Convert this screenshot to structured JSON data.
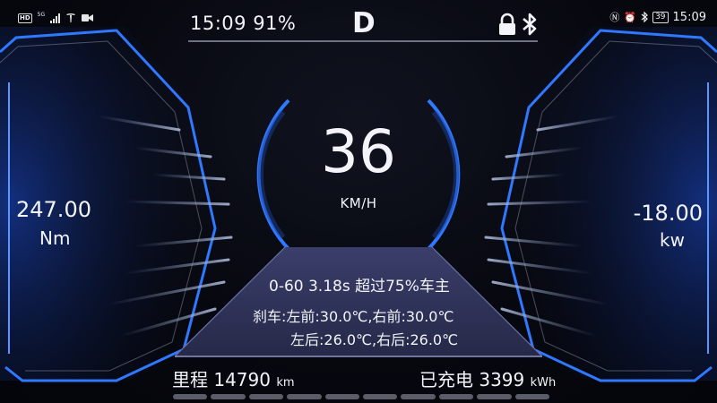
{
  "status_bar": {
    "left_network_badge": "HD",
    "left_network_type": "5G",
    "right_time": "15:09",
    "battery_level": "39",
    "icons": [
      "tesla-logo-icon",
      "video-icon",
      "nfc-icon",
      "alarm-icon",
      "bluetooth-icon",
      "battery-icon"
    ]
  },
  "top_bar": {
    "time_battery": "15:09 91%",
    "gear": "D"
  },
  "speed": {
    "value": "36",
    "unit": "KM/H"
  },
  "torque": {
    "value": "247.00",
    "unit": "Nm"
  },
  "power": {
    "value": "-18.00",
    "unit": "kw"
  },
  "info": {
    "line1": "0-60 3.18s 超过75%车主",
    "line2": "刹车:左前:30.0℃,右前:30.0℃",
    "line3": "左后:26.0℃,右后:26.0℃"
  },
  "bottom": {
    "mileage_label": "里程",
    "mileage_value": "14790",
    "mileage_unit": "km",
    "charged_label": "已充电",
    "charged_value": "3399",
    "charged_unit": "kWh"
  },
  "colors": {
    "accent_blue": "#2f78ff",
    "panel": "#2c2f56",
    "background": "#05060d"
  }
}
